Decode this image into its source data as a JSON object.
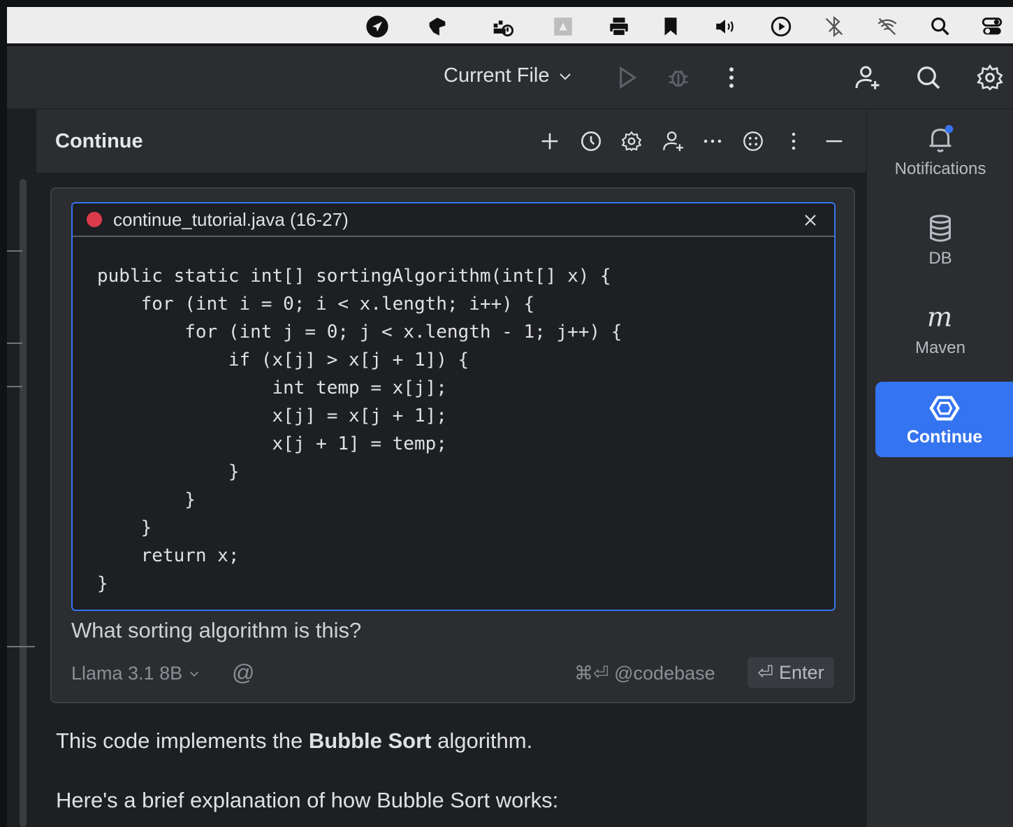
{
  "menubar": {
    "icons": [
      "navigation-icon",
      "box-icon",
      "docker-icon",
      "drive-icon",
      "printer-icon",
      "bookmark-icon",
      "volume-icon",
      "play-circle-icon",
      "bluetooth-off-icon",
      "wifi-off-icon",
      "search-icon",
      "control-center-icon"
    ]
  },
  "toolbar": {
    "run_config": "Current File"
  },
  "panel": {
    "title": "Continue"
  },
  "code_context": {
    "file": "continue_tutorial.java (16-27)",
    "code": "public static int[] sortingAlgorithm(int[] x) {\n    for (int i = 0; i < x.length; i++) {\n        for (int j = 0; j < x.length - 1; j++) {\n            if (x[j] > x[j + 1]) {\n                int temp = x[j];\n                x[j] = x[j + 1];\n                x[j + 1] = temp;\n            }\n        }\n    }\n    return x;\n}"
  },
  "input": {
    "question": "What sorting algorithm is this?",
    "model": "Llama 3.1 8B",
    "at_symbol": "@",
    "codebase_hint": "⌘⏎ @codebase",
    "enter_label": "Enter"
  },
  "response": {
    "line1_pre": "This code implements the ",
    "line1_bold": "Bubble Sort",
    "line1_post": " algorithm.",
    "line2": "Here's a brief explanation of how Bubble Sort works:"
  },
  "rightbar": {
    "notifications": "Notifications",
    "db": "DB",
    "maven": "Maven",
    "continue": "Continue"
  },
  "colors": {
    "accent": "#3574f0",
    "error": "#db3b4b"
  }
}
